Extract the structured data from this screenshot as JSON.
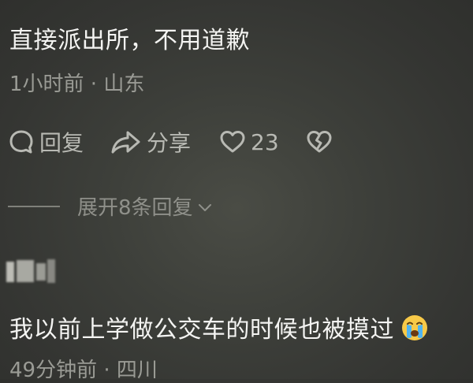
{
  "comments": [
    {
      "text": "直接派出所，不用道歉",
      "time": "1小时前",
      "separator": " · ",
      "location": "山东",
      "actions": {
        "reply_label": "回复",
        "share_label": "分享",
        "like_count": "23"
      },
      "expand_replies_label": "展开8条回复"
    },
    {
      "text": "我以前上学做公交车的时候也被摸过",
      "emoji": "crying-face-icon",
      "time": "49分钟前",
      "separator": " · ",
      "location": "四川"
    }
  ],
  "colors": {
    "text": "#f4f4f2",
    "meta": "#9a9b95",
    "icon": "#b8b9b3"
  }
}
